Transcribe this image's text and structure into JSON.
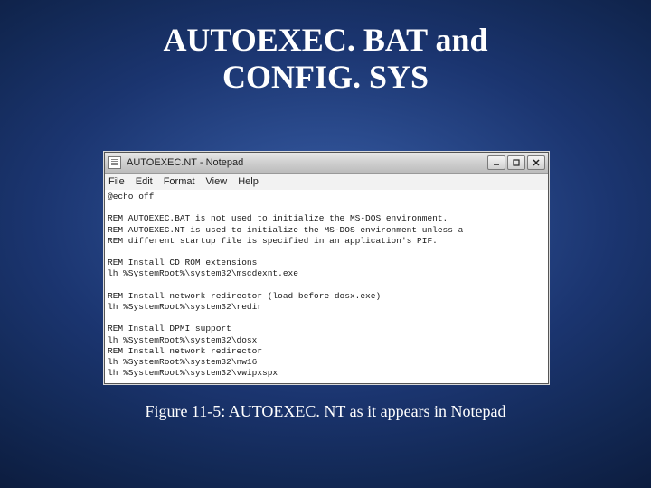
{
  "slide": {
    "title_line1": "AUTOEXEC. BAT and",
    "title_line2": "CONFIG. SYS",
    "caption": "Figure 11-5: AUTOEXEC. NT as it appears in Notepad"
  },
  "window": {
    "title": "AUTOEXEC.NT - Notepad"
  },
  "menu": {
    "file": "File",
    "edit": "Edit",
    "format": "Format",
    "view": "View",
    "help": "Help"
  },
  "file": {
    "lines": [
      "@echo off",
      "",
      "REM AUTOEXEC.BAT is not used to initialize the MS-DOS environment.",
      "REM AUTOEXEC.NT is used to initialize the MS-DOS environment unless a",
      "REM different startup file is specified in an application's PIF.",
      "",
      "REM Install CD ROM extensions",
      "lh %SystemRoot%\\system32\\mscdexnt.exe",
      "",
      "REM Install network redirector (load before dosx.exe)",
      "lh %SystemRoot%\\system32\\redir",
      "",
      "REM Install DPMI support",
      "lh %SystemRoot%\\system32\\dosx",
      "REM Install network redirector",
      "lh %SystemRoot%\\system32\\nw16",
      "lh %SystemRoot%\\system32\\vwipxspx"
    ]
  }
}
